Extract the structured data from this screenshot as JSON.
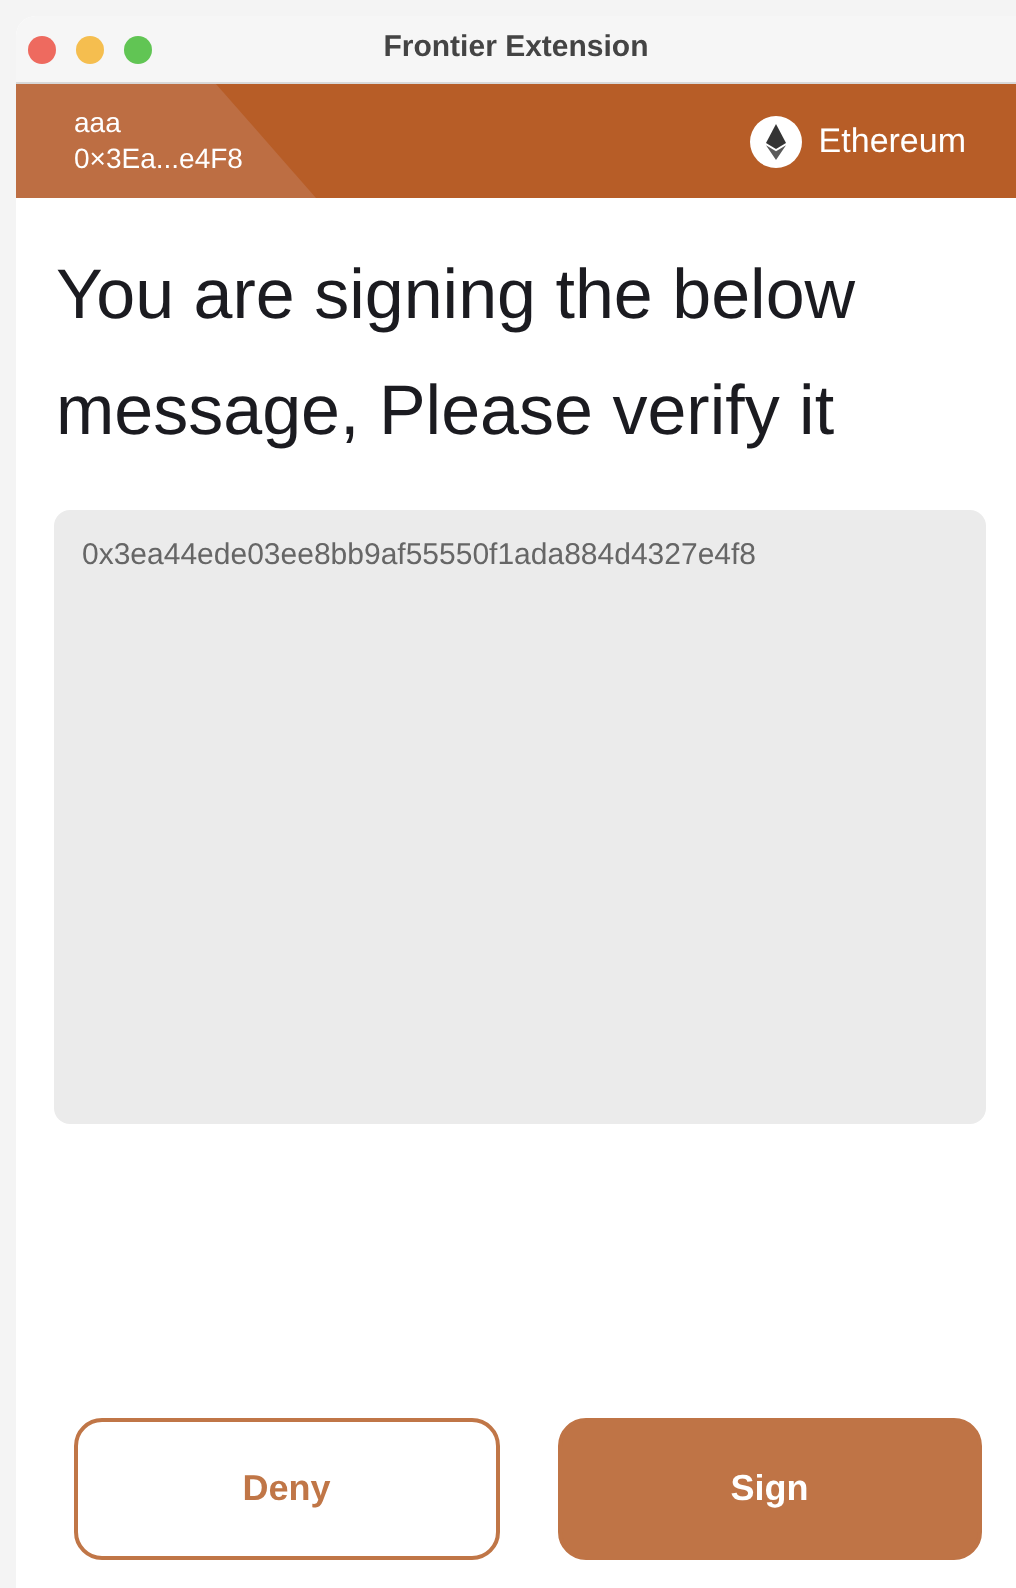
{
  "window": {
    "title": "Frontier Extension"
  },
  "account": {
    "name": "aaa",
    "address": "0×3Ea...e4F8"
  },
  "network": {
    "name": "Ethereum"
  },
  "heading": "You are signing the below message, Please verify it",
  "message": "0x3ea44ede03ee8bb9af55550f1ada884d4327e4f8",
  "buttons": [
    {
      "label": "Deny",
      "kind": "outline"
    },
    {
      "label": "Sign",
      "kind": "primary"
    }
  ]
}
